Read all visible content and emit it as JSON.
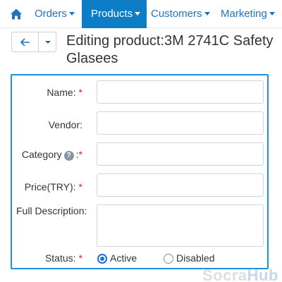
{
  "nav": {
    "home_icon": "home-icon",
    "items": [
      {
        "label": "Orders"
      },
      {
        "label": "Products"
      },
      {
        "label": "Customers"
      },
      {
        "label": "Marketing"
      }
    ],
    "active": "Products",
    "accent_color": "#0d7dc7"
  },
  "header": {
    "back_icon": "arrow-left-icon",
    "dropdown_icon": "chevron-down-icon",
    "title": "Editing product:3M 2741C Safety Glasees"
  },
  "form": {
    "fields": {
      "name": {
        "label": "Name:",
        "required": "*",
        "value": ""
      },
      "vendor": {
        "label": "Vendor:",
        "value": ""
      },
      "category": {
        "label": "Category",
        "help": "?",
        "colon": ":",
        "required": "*",
        "value": ""
      },
      "price": {
        "label": "Price(TRY):",
        "required": "*",
        "value": ""
      },
      "description": {
        "label": "Full Description:",
        "value": ""
      }
    },
    "status": {
      "label": "Status:",
      "required": "*",
      "options": [
        {
          "label": "Active",
          "checked": true
        },
        {
          "label": "Disabled",
          "checked": false
        }
      ]
    },
    "border_color": "#1e90e0"
  },
  "watermark": {
    "part1": "Socra",
    "part2": "Hub"
  }
}
